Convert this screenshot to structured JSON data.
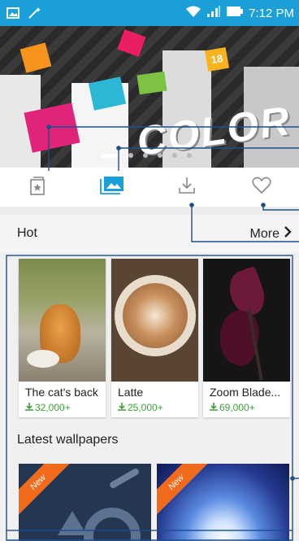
{
  "status_bar": {
    "time": "7:12 PM",
    "icons": [
      "image-icon",
      "sparkle-icon",
      "wifi-icon",
      "signal-icon",
      "battery-icon"
    ]
  },
  "hero": {
    "title": "COLOR",
    "sticker_number": "18",
    "slides": 6,
    "active_slide": 1
  },
  "tabs": [
    {
      "icon": "wallpaper-book-icon",
      "active": false
    },
    {
      "icon": "gallery-icon",
      "active": true
    },
    {
      "icon": "download-icon",
      "active": false
    },
    {
      "icon": "heart-icon",
      "active": false
    }
  ],
  "hot": {
    "title": "Hot",
    "more_label": "More"
  },
  "cards": [
    {
      "name": "The cat's back",
      "count": "32,000+"
    },
    {
      "name": "Latte",
      "count": "25,000+"
    },
    {
      "name": "Zoom Blade...",
      "count": "69,000+"
    }
  ],
  "latest": {
    "title": "Latest wallpapers",
    "items": [
      {
        "badge": "New"
      },
      {
        "badge": "New"
      }
    ]
  },
  "colors": {
    "status_bar": "#1a9fd8",
    "active_tab": "#1a9fd8",
    "download_count": "#3aa135",
    "new_badge": "#f26a1b",
    "annotation_line": "#1b4f8f"
  }
}
